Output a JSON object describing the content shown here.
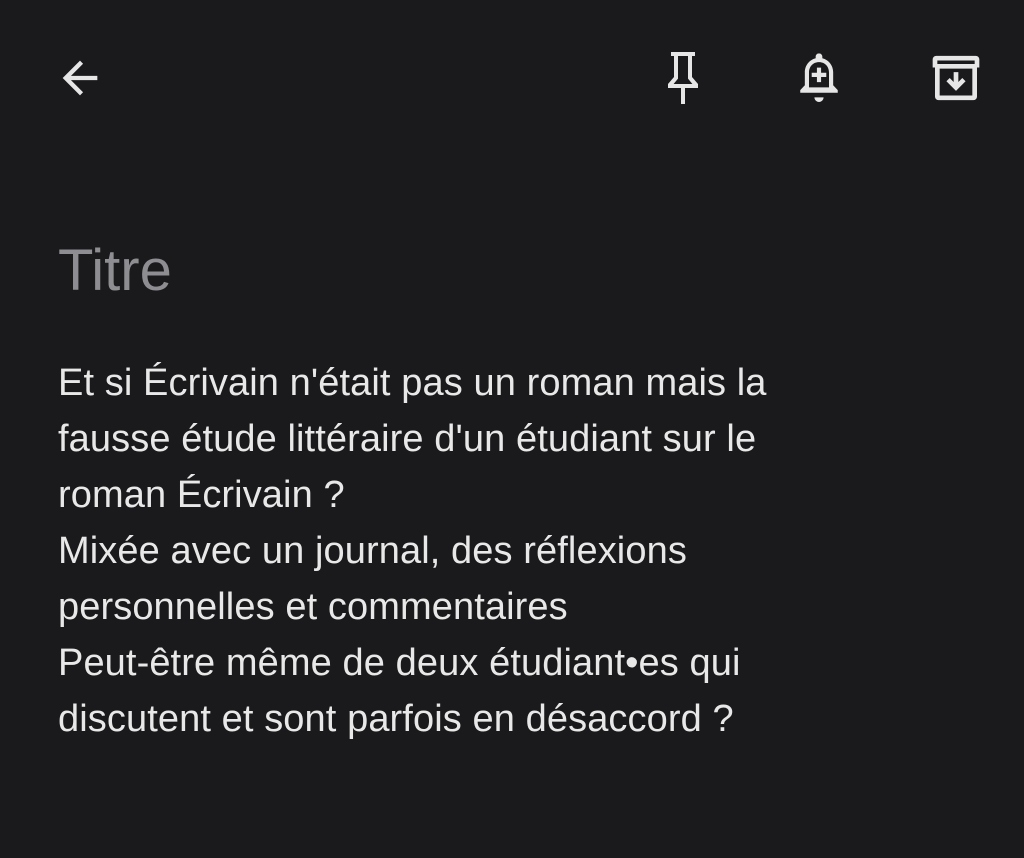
{
  "toolbar": {
    "back_icon": "arrow-left-icon",
    "pin_icon": "pin-icon",
    "reminder_icon": "bell-plus-icon",
    "archive_icon": "archive-icon",
    "icon_color": "#e6e6e6"
  },
  "note": {
    "title_placeholder": "Titre",
    "body_lines": [
      "Et si Écrivain n'était pas un roman mais la",
      "fausse étude littéraire d'un étudiant sur le",
      "roman Écrivain ?",
      "Mixée avec un journal, des réflexions",
      "personnelles et commentaires",
      "Peut-être même de deux étudiant•es qui",
      "discutent et sont parfois en désaccord ?"
    ]
  },
  "theme": {
    "background": "#1a1a1c",
    "text": "#e8e8e8",
    "placeholder": "#8e8e92"
  }
}
